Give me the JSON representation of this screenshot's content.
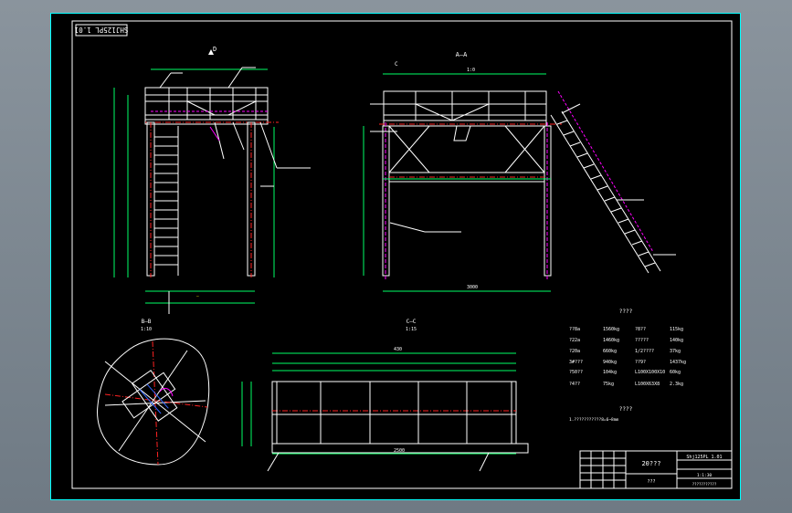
{
  "drawing": {
    "stamp": "SHJ125PL 1.01",
    "views": {
      "front": {
        "label": "D"
      },
      "side": {
        "label": "A—A",
        "tag_c": "C"
      },
      "section_b": {
        "label": "B—B",
        "scale": "1:10"
      },
      "section_c": {
        "label": "C—C",
        "scale": "1:15"
      }
    },
    "dims": {
      "side_top": "1:0",
      "side_mid": "3000",
      "plan_total": "430",
      "plan_bottom": "2500"
    },
    "materials": {
      "title": "????",
      "rows": [
        {
          "item": "??8a",
          "weight": "1560kg",
          "item2": "?8??",
          "weight2": "115kg"
        },
        {
          "item": "?22a",
          "weight": "1460kg",
          "item2": "?????",
          "weight2": "140kg"
        },
        {
          "item": "?20a",
          "weight": "660kg",
          "item2": "1/2????",
          "weight2": "37kg"
        },
        {
          "item": "3#???",
          "weight": "940kg",
          "item2": "??9?",
          "weight2": "1437kg"
        },
        {
          "item": "?50??",
          "weight": "104kg",
          "item2": "L100X100X10",
          "weight2": "60kg"
        },
        {
          "item": "?4??",
          "weight": "75kg",
          "item2": "L100X63X8",
          "weight2": "2.3kg"
        }
      ]
    },
    "notes": {
      "title": "????",
      "text": "1.???????????8=6~8mm"
    },
    "title_block": {
      "name": "20???",
      "code": "Shj125PL 1.01",
      "scale": "1:1:30",
      "company": "???",
      "footer": "???????????"
    },
    "colors": {
      "background": "#000000",
      "frame": "#00ffff",
      "lines": "#ffffff",
      "centerline": "#ff2222",
      "dimension": "#00ff66",
      "hidden": "#ff00ff",
      "annotation": "#ffff00",
      "hatch": "#3366ff"
    }
  }
}
